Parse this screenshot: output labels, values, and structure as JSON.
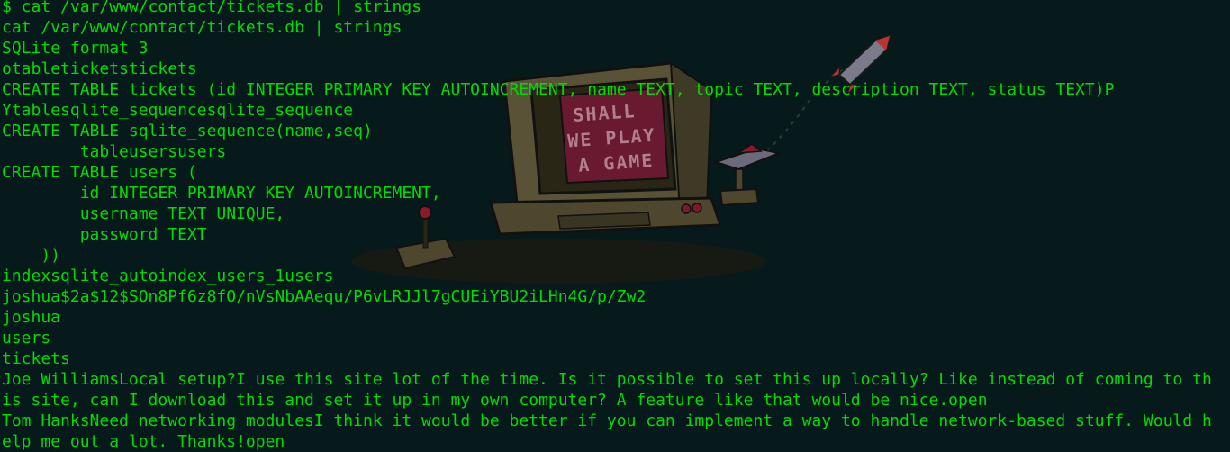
{
  "terminal": {
    "lines": [
      "$ cat /var/www/contact/tickets.db | strings",
      "cat /var/www/contact/tickets.db | strings",
      "SQLite format 3",
      "otableticketstickets",
      "CREATE TABLE tickets (id INTEGER PRIMARY KEY AUTOINCREMENT, name TEXT, topic TEXT, description TEXT, status TEXT)P",
      "Ytablesqlite_sequencesqlite_sequence",
      "CREATE TABLE sqlite_sequence(name,seq)",
      "        tableusersusers",
      "CREATE TABLE users (",
      "        id INTEGER PRIMARY KEY AUTOINCREMENT,",
      "        username TEXT UNIQUE,",
      "        password TEXT",
      "    ))",
      "indexsqlite_autoindex_users_1users",
      "joshua$2a$12$SOn8Pf6z8fO/nVsNbAAequ/P6vLRJJl7gCUEiYBU2iLHn4G/p/Zw2",
      "joshua",
      "users",
      "tickets",
      "Joe WilliamsLocal setup?I use this site lot of the time. Is it possible to set this up locally? Like instead of coming to th",
      "is site, can I download this and set it up in my own computer? A feature like that would be nice.open",
      "Tom HanksNeed networking modulesI think it would be better if you can implement a way to handle network-based stuff. Would h",
      "elp me out a lot. Thanks!open"
    ]
  },
  "wallpaper": {
    "screen_text": [
      "SHALL",
      "WE PLAY",
      "A GAME"
    ],
    "colors": {
      "background": "#061a1c",
      "terminal_text": "#00dc00",
      "monitor_body": "#5a5236",
      "crt_screen": "#6a1a30"
    }
  }
}
